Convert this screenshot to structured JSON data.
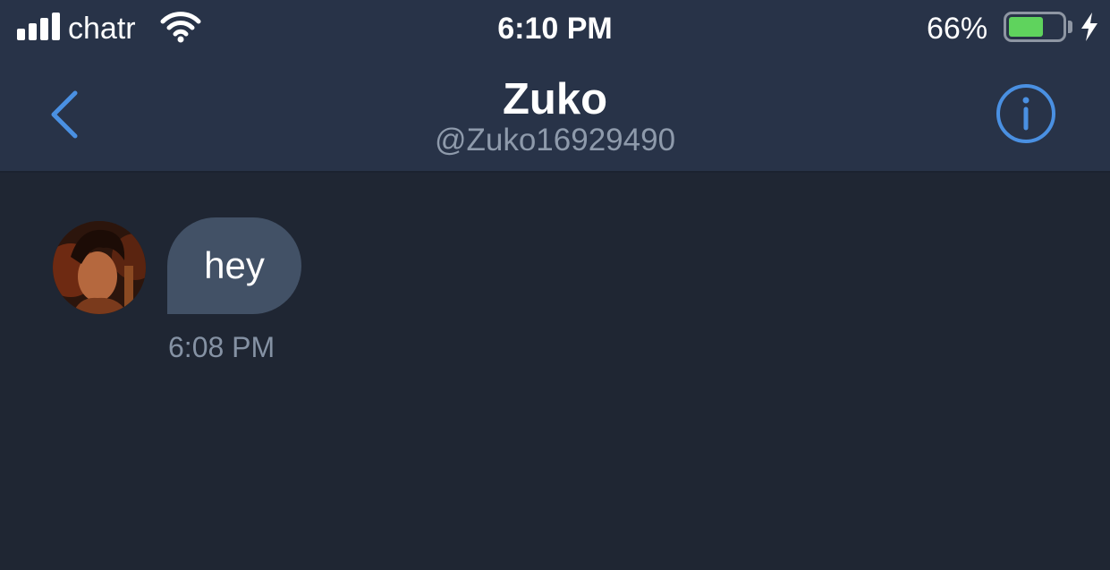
{
  "status_bar": {
    "carrier": "chatr",
    "time": "6:10 PM",
    "battery_percent": "66%",
    "battery_level": 0.66,
    "battery_color": "#5fd35d",
    "charging": true
  },
  "nav": {
    "back_icon": "chevron-left-icon",
    "title": "Zuko",
    "handle": "@Zuko16929490",
    "info_icon": "info-circle-icon",
    "accent_color": "#4a90e2"
  },
  "conversation": {
    "messages": [
      {
        "sender": "Zuko",
        "avatar_icon": "avatar",
        "text": "hey",
        "time": "6:08 PM"
      }
    ]
  },
  "colors": {
    "header_bg": "#283348",
    "chat_bg": "#1f2633",
    "bubble_bg": "#425166",
    "secondary_text": "#8e9aab"
  }
}
